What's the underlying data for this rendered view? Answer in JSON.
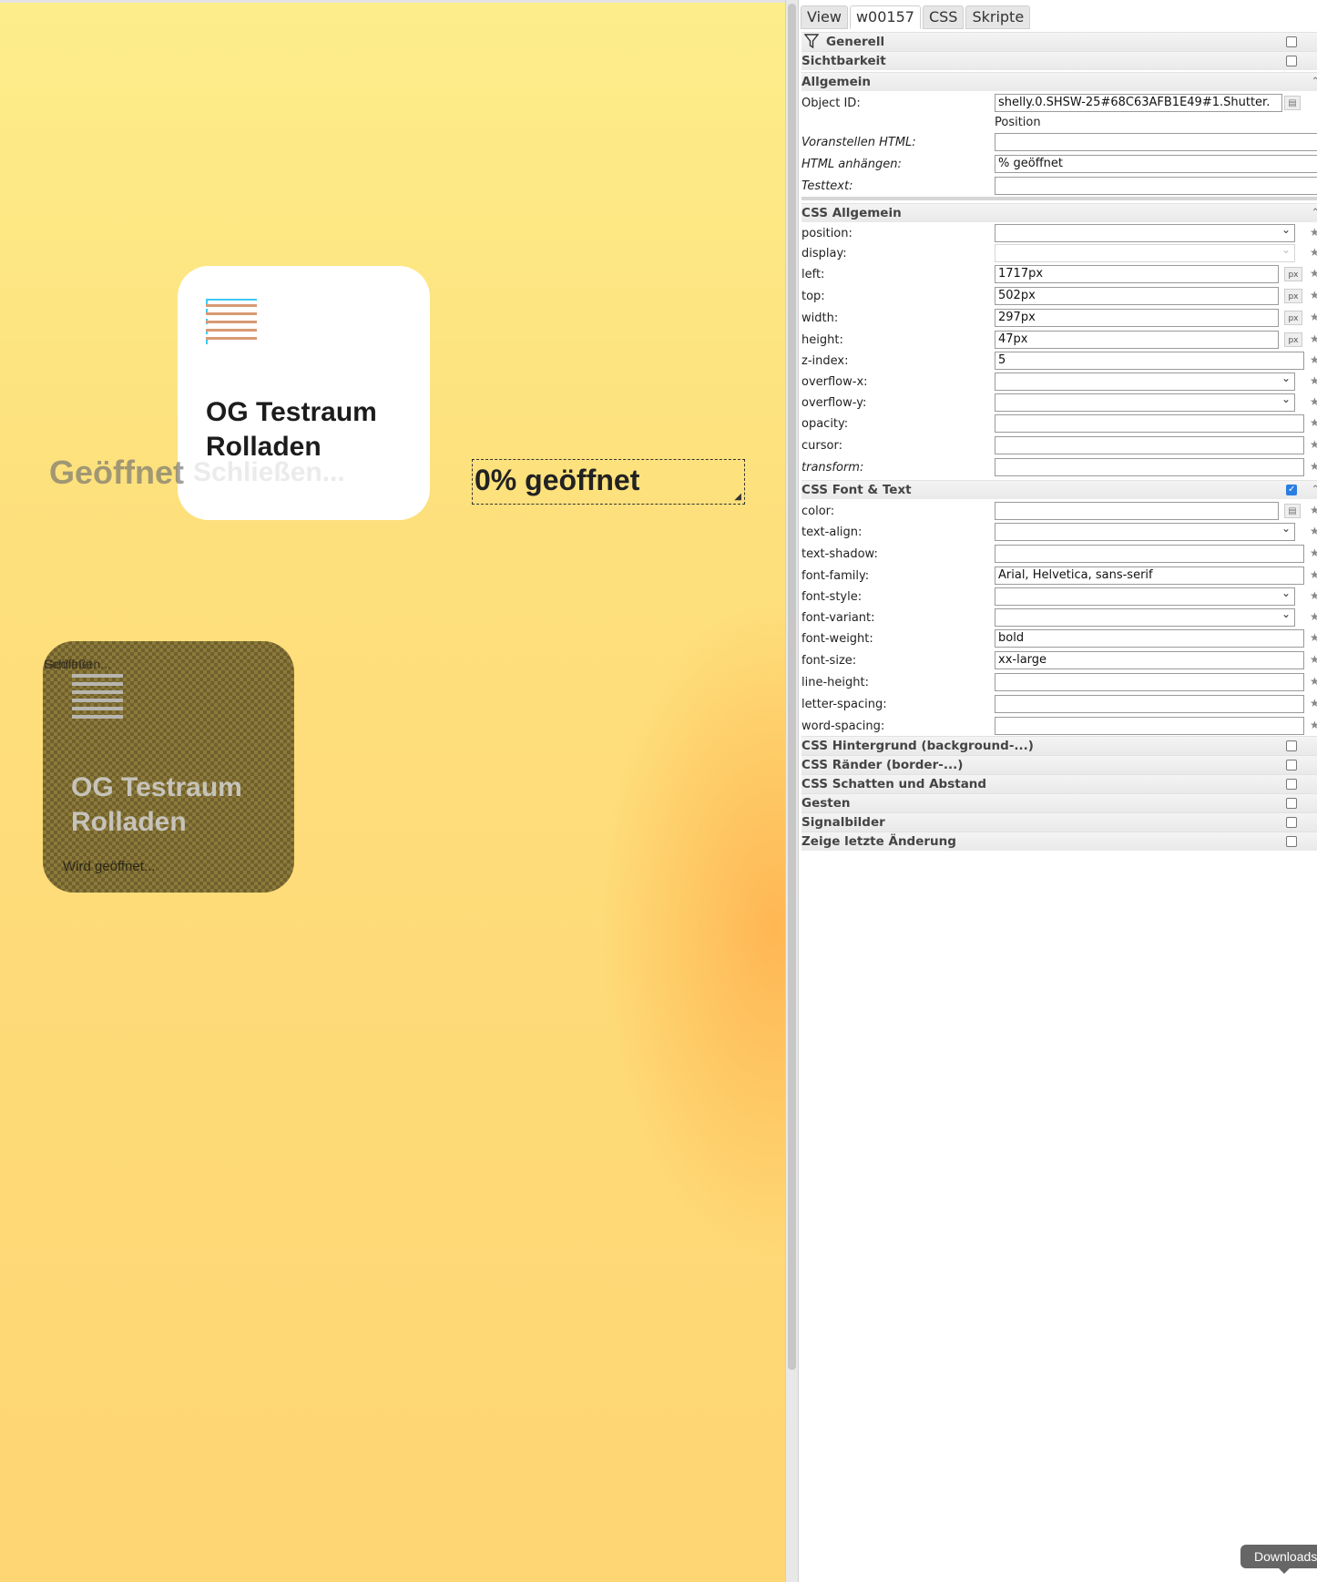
{
  "canvas": {
    "card_main": {
      "title_line1": "OG Testraum",
      "title_line2": "Rolladen"
    },
    "state_open": "Geöffnet",
    "state_close": "Schließen...",
    "position_widget": {
      "value": "0% geöffnet"
    },
    "card_ghost": {
      "title_line1": "OG Testraum",
      "title_line2": "Rolladen",
      "overlap_a": "Geöffnet",
      "overlap_b": "Schließen...",
      "status": "Wird geöffnet..."
    }
  },
  "panel": {
    "tabs": [
      "View",
      "w00157",
      "CSS",
      "Skripte"
    ],
    "sections": {
      "generell": "Generell",
      "sichtbarkeit": "Sichtbarkeit",
      "allgemein": "Allgemein",
      "css_allgemein": "CSS Allgemein",
      "css_font": "CSS Font & Text",
      "css_hintergrund": "CSS Hintergrund (background-...)",
      "css_raender": "CSS Ränder (border-...)",
      "css_schatten": "CSS Schatten und Abstand",
      "gesten": "Gesten",
      "signalbilder": "Signalbilder",
      "letzte_aenderung": "Zeige letzte Änderung"
    },
    "allgemein": {
      "object_id_label": "Object ID:",
      "object_id_value": "shelly.0.SHSW-25#68C63AFB1E49#1.Shutter.",
      "object_id_hint": "Position",
      "prepend_label": "Voranstellen HTML:",
      "prepend_value": "",
      "append_label": "HTML anhängen:",
      "append_value": "% geöffnet",
      "testtext_label": "Testtext:",
      "testtext_value": ""
    },
    "css_allgemein": [
      {
        "label": "position:",
        "value": "",
        "type": "select"
      },
      {
        "label": "display:",
        "value": "",
        "type": "select-disabled"
      },
      {
        "label": "left:",
        "value": "1717px",
        "type": "unit",
        "unit": "px"
      },
      {
        "label": "top:",
        "value": "502px",
        "type": "unit",
        "unit": "px"
      },
      {
        "label": "width:",
        "value": "297px",
        "type": "unit",
        "unit": "px"
      },
      {
        "label": "height:",
        "value": "47px",
        "type": "unit",
        "unit": "px"
      },
      {
        "label": "z-index:",
        "value": "5",
        "type": "text"
      },
      {
        "label": "overflow-x:",
        "value": "",
        "type": "select"
      },
      {
        "label": "overflow-y:",
        "value": "",
        "type": "select"
      },
      {
        "label": "opacity:",
        "value": "",
        "type": "text"
      },
      {
        "label": "cursor:",
        "value": "",
        "type": "text"
      },
      {
        "label": "transform:",
        "value": "",
        "type": "text",
        "italic": true
      }
    ],
    "css_font": [
      {
        "label": "color:",
        "value": "",
        "type": "color"
      },
      {
        "label": "text-align:",
        "value": "",
        "type": "select"
      },
      {
        "label": "text-shadow:",
        "value": "",
        "type": "text"
      },
      {
        "label": "font-family:",
        "value": "Arial, Helvetica, sans-serif",
        "type": "text"
      },
      {
        "label": "font-style:",
        "value": "",
        "type": "select"
      },
      {
        "label": "font-variant:",
        "value": "",
        "type": "select"
      },
      {
        "label": "font-weight:",
        "value": "bold",
        "type": "text"
      },
      {
        "label": "font-size:",
        "value": "xx-large",
        "type": "text"
      },
      {
        "label": "line-height:",
        "value": "",
        "type": "text"
      },
      {
        "label": "letter-spacing:",
        "value": "",
        "type": "text"
      },
      {
        "label": "word-spacing:",
        "value": "",
        "type": "text"
      }
    ],
    "font_section_checked": true
  },
  "downloads_label": "Downloads",
  "colors": {
    "accent": "#2a7de1",
    "card_icon": "#d89a72",
    "selection": "#40c8f0",
    "canvas_bg": "#fde17d"
  }
}
